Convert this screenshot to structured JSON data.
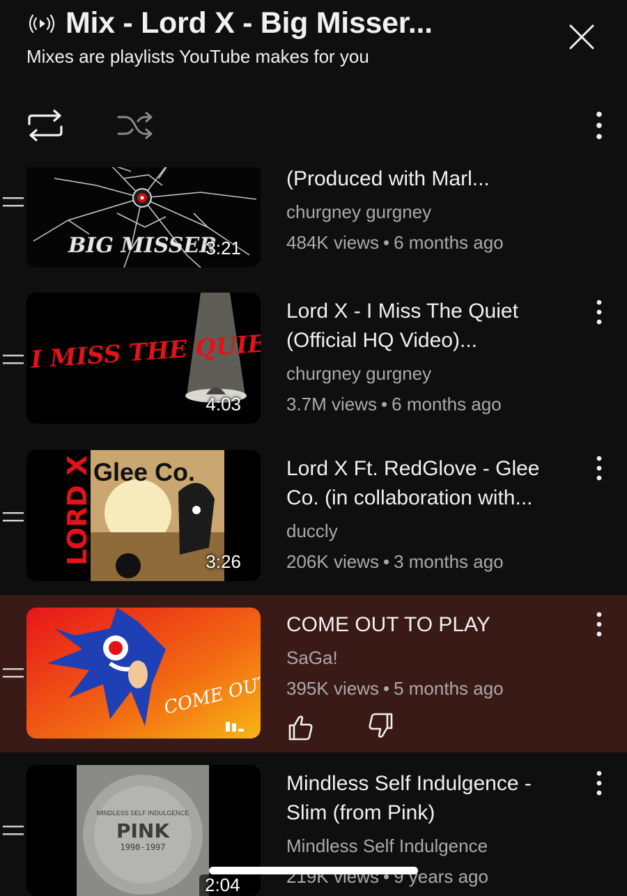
{
  "header": {
    "title": "Mix - Lord X - Big Misser...",
    "subtitle": "Mixes are playlists YouTube makes for you",
    "mix_icon": "broadcast-play-icon",
    "close_icon": "close-icon",
    "repeat_icon": "repeat-icon",
    "shuffle_icon": "shuffle-icon",
    "menu_icon": "more-vertical-icon"
  },
  "colors": {
    "background": "#0f0f0f",
    "active_row": "#3a1a16",
    "secondary_text": "#aaaaaa"
  },
  "items": [
    {
      "title": "(Produced with Marl...",
      "channel": "churgney gurgney",
      "views": "484K views",
      "age": "6 months ago",
      "duration": "3:21",
      "thumb_text": "BIG MISSER"
    },
    {
      "title": "Lord X - I Miss The Quiet (Official HQ Video)...",
      "channel": "churgney gurgney",
      "views": "3.7M views",
      "age": "6 months ago",
      "duration": "4:03",
      "thumb_text": "I MISS THE QUIET"
    },
    {
      "title": "Lord X Ft. RedGlove - Glee Co. (in collaboration with...",
      "channel": "duccly",
      "views": "206K views",
      "age": "3 months ago",
      "duration": "3:26",
      "thumb_text_a": "LORD X",
      "thumb_text_b": "Glee Co."
    },
    {
      "title": "COME OUT TO PLAY",
      "channel": "SaGa!",
      "views": "395K views",
      "age": "5 months ago",
      "playing": true,
      "thumb_text": "COME OUT TO PLAY",
      "like_icon": "thumbs-up-icon",
      "dislike_icon": "thumbs-down-icon"
    },
    {
      "title": "Mindless Self Indulgence - Slim (from Pink)",
      "channel": "Mindless Self Indulgence",
      "views": "219K views",
      "age": "9 years ago",
      "duration": "2:04",
      "thumb_text_a": "MINDLESS SELF INDULGENCE",
      "thumb_text_b": "PINK",
      "thumb_text_c": "1990-1997"
    }
  ],
  "separator": "•"
}
